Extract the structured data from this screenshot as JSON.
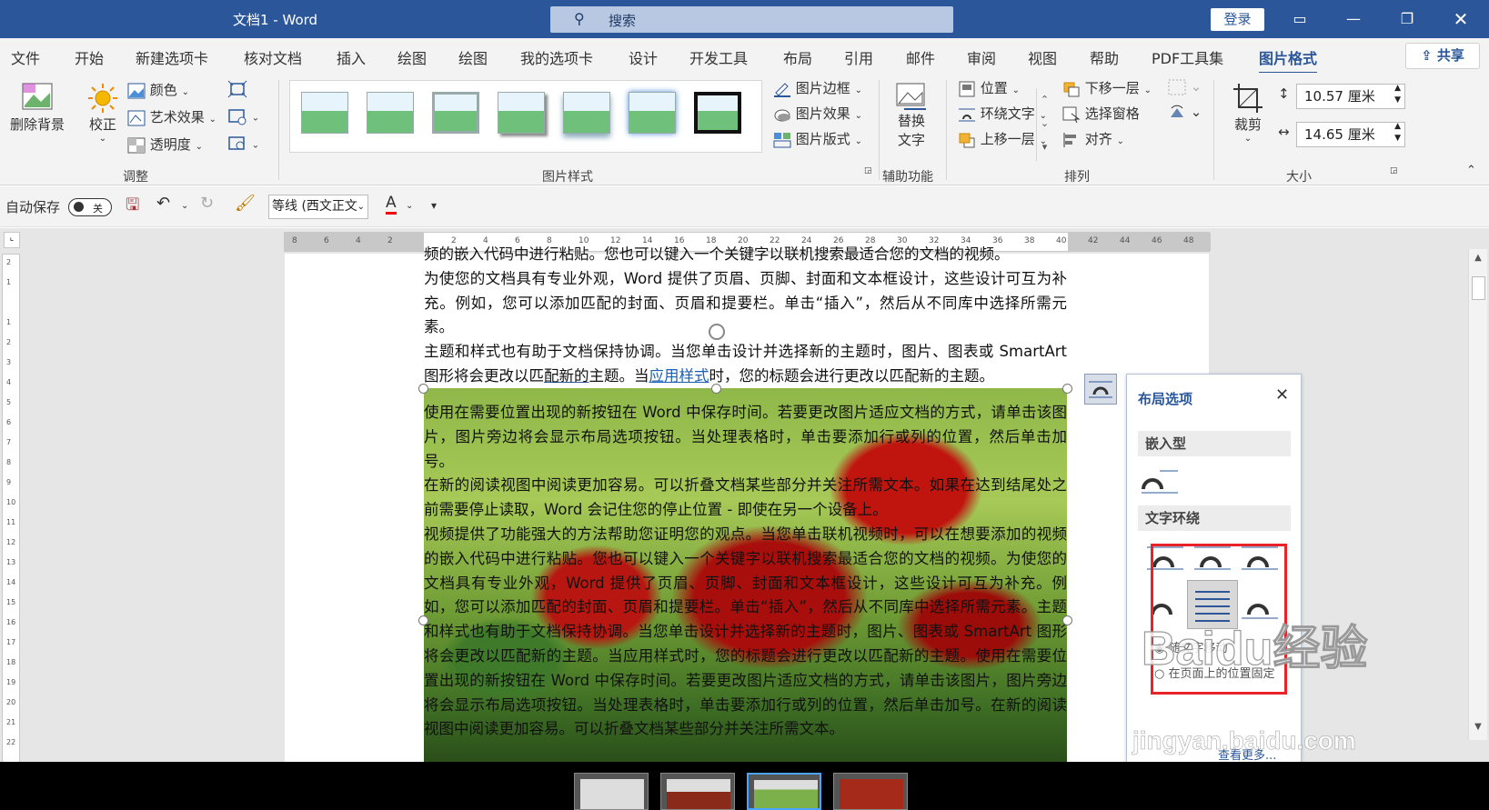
{
  "titlebar": {
    "title": "文档1  -  Word",
    "search_placeholder": "搜索",
    "login_label": "登录"
  },
  "menu": {
    "tabs": [
      "文件",
      "开始",
      "新建选项卡",
      "核对文档",
      "插入",
      "绘图",
      "绘图",
      "我的选项卡",
      "设计",
      "开发工具",
      "布局",
      "引用",
      "邮件",
      "审阅",
      "视图",
      "帮助",
      "PDF工具集",
      "图片格式"
    ],
    "active_tab": "图片格式",
    "share_label": "共享"
  },
  "ribbon": {
    "remove_bg": "删除背景",
    "correct": "校正",
    "color": "颜色",
    "art_effects": "艺术效果",
    "transparency": "透明度",
    "group_adjust": "调整",
    "picture_border": "图片边框",
    "picture_effects": "图片效果",
    "picture_layout": "图片版式",
    "group_styles": "图片样式",
    "alt_text_line1": "替换",
    "alt_text_line2": "文字",
    "group_accessibility": "辅助功能",
    "position": "位置",
    "wrap_text": "环绕文字",
    "bring_forward": "上移一层",
    "send_backward": "下移一层",
    "selection_pane": "选择窗格",
    "align": "对齐",
    "group_arrange": "排列",
    "crop": "裁剪",
    "height_value": "10.57 厘米",
    "width_value": "14.65 厘米",
    "group_size": "大小"
  },
  "qat": {
    "autosave_label": "自动保存",
    "autosave_state": "关",
    "font_name": "等线 (西文正文"
  },
  "ruler": {
    "h_ticks": [
      "8",
      "6",
      "4",
      "2",
      "",
      "2",
      "4",
      "6",
      "8",
      "10",
      "12",
      "14",
      "16",
      "18",
      "20",
      "22",
      "24",
      "26",
      "28",
      "30",
      "32",
      "34",
      "36",
      "38",
      "40",
      "42",
      "44",
      "46",
      "48"
    ],
    "v_ticks": [
      "2",
      "1",
      "",
      "1",
      "2",
      "3",
      "4",
      "5",
      "6",
      "7",
      "8",
      "9",
      "10",
      "11",
      "12",
      "13",
      "14",
      "15",
      "16",
      "17",
      "18",
      "19",
      "20",
      "21",
      "22"
    ]
  },
  "document": {
    "line0": "频的嵌入代码中进行粘贴。您也可以键入一个关键字以联机搜索最适合您的文档的视频。",
    "p1": "为使您的文档具有专业外观，Word 提供了页眉、页脚、封面和文本框设计，这些设计可互为补充。例如，您可以添加匹配的封面、页眉和提要栏。单击“插入”，然后从不同库中选择所需元素。",
    "p2_a": "主题和样式也有助于文档保持协调。当您单击设计并选择新的主题时，图片、图表或 SmartArt 图形将会更改以匹",
    "p2_ul": "配新的",
    "p2_b": "主题。当",
    "p2_link": "应用样式",
    "p2_c": "时，您的标题会进行更改以匹配新的主题。",
    "pic_p1": "使用在需要位置出现的新按钮在 Word 中保存时间。若要更改图片适应文档的方式，请单击该图片，图片旁边将会显示布局选项按钮。当处理表格时，单击要添加行或列的位置，然后单击加号。",
    "pic_p2_ul": "处之前",
    "pic_p2_a": "在新的阅读视图中阅读更加容易。可以折叠文档某些部分并关注所需文本。如果在达到结尾",
    "pic_p2_b": "需要停止读取，Word 会记住您的停止位置 - 即使在另一个设备上。",
    "pic_p3": "视频提供了功能强大的方法帮助您证明您的观点。当您单击联机视频时，可以在想要添加的视频的嵌入代码中进行粘贴。您也可以键入一个关键字以联机搜索最适合您的文档的视频。为使您的文档具有专业外观，Word 提供了页眉、页脚、封面和文本框设计，这些设计可互为补充。例如，您可以添加匹配的封面、页眉和提要栏。单击“插入”，然后从不同库中选择所需元素。主题和样式也有助于文档保持协调。当您单击设计并选择新的主题时，图片、图表或 SmartArt 图形将会更改以匹配新的主题。当应用样式时，您的标题会进行更改以匹配新的主题。使用在需要位置出现的新按钮在 Word 中保存时间。若要更改图片适应文档的方式，请单击该图片，图片旁边将会显示布局选项按钮。当处理表格时，单击要添加行或列的位置，然后单击加号。在新的阅读视图中阅读更加容易。可以折叠文档某些部分并关注所需文本。"
  },
  "layout_panel": {
    "title": "布局选项",
    "inline_section": "嵌入型",
    "wrap_section": "文字环绕",
    "move_with_text": "随文字移动",
    "fix_on_page": "在页面上的位置固定",
    "see_more": "查看更多..."
  },
  "watermark": {
    "brand": "Baidu经验",
    "url": "jingyan.baidu.com"
  },
  "colors": {
    "title_blue": "#2b579a",
    "highlight_red": "#e8242a"
  }
}
